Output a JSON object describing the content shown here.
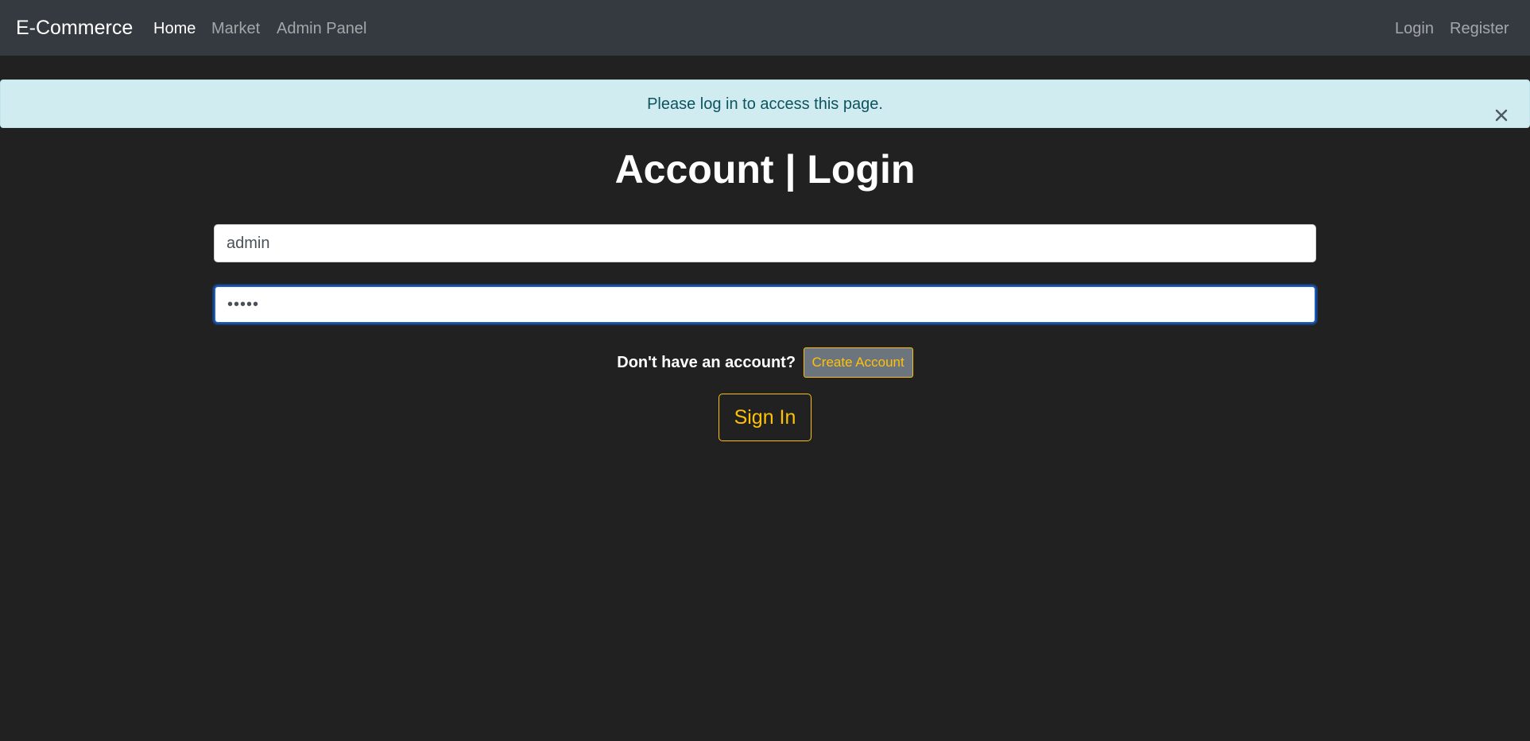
{
  "navbar": {
    "brand": "E-Commerce",
    "links": [
      {
        "label": "Home",
        "active": true
      },
      {
        "label": "Market",
        "active": false
      },
      {
        "label": "Admin Panel",
        "active": false
      }
    ],
    "right_links": [
      {
        "label": "Login"
      },
      {
        "label": "Register"
      }
    ]
  },
  "alert": {
    "message": "Please log in to access this page.",
    "close_icon": "close-icon"
  },
  "page": {
    "title": "Account | Login"
  },
  "form": {
    "username_value": "admin",
    "password_value": "•••••",
    "signup_prompt": "Don't have an account?",
    "create_account_label": "Create Account",
    "sign_in_label": "Sign In"
  },
  "colors": {
    "background": "#212121",
    "navbar": "#343a40",
    "alert_bg": "#d1ecf1",
    "alert_text": "#0c5460",
    "accent": "#ffc107",
    "focus_border": "#1a5ec4"
  }
}
